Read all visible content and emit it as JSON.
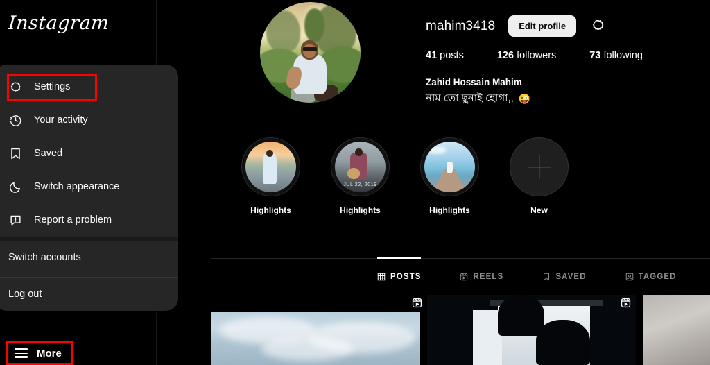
{
  "app": {
    "logo_text": "Instagram"
  },
  "nav": {
    "more_label": "More",
    "more_icon": "hamburger-icon"
  },
  "menu": {
    "items": [
      {
        "label": "Settings",
        "icon": "gear-icon",
        "highlighted": true
      },
      {
        "label": "Your activity",
        "icon": "clock-activity-icon",
        "highlighted": false
      },
      {
        "label": "Saved",
        "icon": "bookmark-icon",
        "highlighted": false
      },
      {
        "label": "Switch appearance",
        "icon": "moon-icon",
        "highlighted": false
      },
      {
        "label": "Report a problem",
        "icon": "report-problem-icon",
        "highlighted": false
      }
    ],
    "switch_accounts_label": "Switch accounts",
    "log_out_label": "Log out",
    "highlight_color": "#ff0000"
  },
  "profile": {
    "username": "mahim3418",
    "edit_profile_label": "Edit profile",
    "settings_icon": "gear-icon",
    "avatar_alt": "profile-photo",
    "stats": [
      {
        "count": "41",
        "label": "posts"
      },
      {
        "count": "126",
        "label": "followers"
      },
      {
        "count": "73",
        "label": "following"
      }
    ],
    "full_name": "Zahid Hossain Mahim",
    "bio": "নাম তো ছুনাই হোগা,,",
    "bio_emoji": "😜"
  },
  "highlights": [
    {
      "label": "Highlights",
      "overlay_text": ""
    },
    {
      "label": "Highlights",
      "overlay_text": "JUL 22, 2019"
    },
    {
      "label": "Highlights",
      "overlay_text": ""
    }
  ],
  "highlight_new": {
    "label": "New",
    "icon": "plus-icon"
  },
  "tabs": [
    {
      "label": "POSTS",
      "icon": "grid-icon",
      "active": true
    },
    {
      "label": "REELS",
      "icon": "reels-icon",
      "active": false
    },
    {
      "label": "SAVED",
      "icon": "bookmark-icon",
      "active": false
    },
    {
      "label": "TAGGED",
      "icon": "tagged-person-icon",
      "active": false
    }
  ],
  "posts": [
    {
      "alt": "cloudy-sky-post",
      "is_reel": true
    },
    {
      "alt": "dark-silhouette-post",
      "is_reel": true
    },
    {
      "alt": "gray-post",
      "is_reel": false
    }
  ],
  "colors": {
    "background": "#000000",
    "menu_background": "#262626",
    "accent_white": "#ffffff",
    "muted_text": "#8e8e8e",
    "highlight_red": "#ff0000",
    "button_light": "#efefef"
  }
}
